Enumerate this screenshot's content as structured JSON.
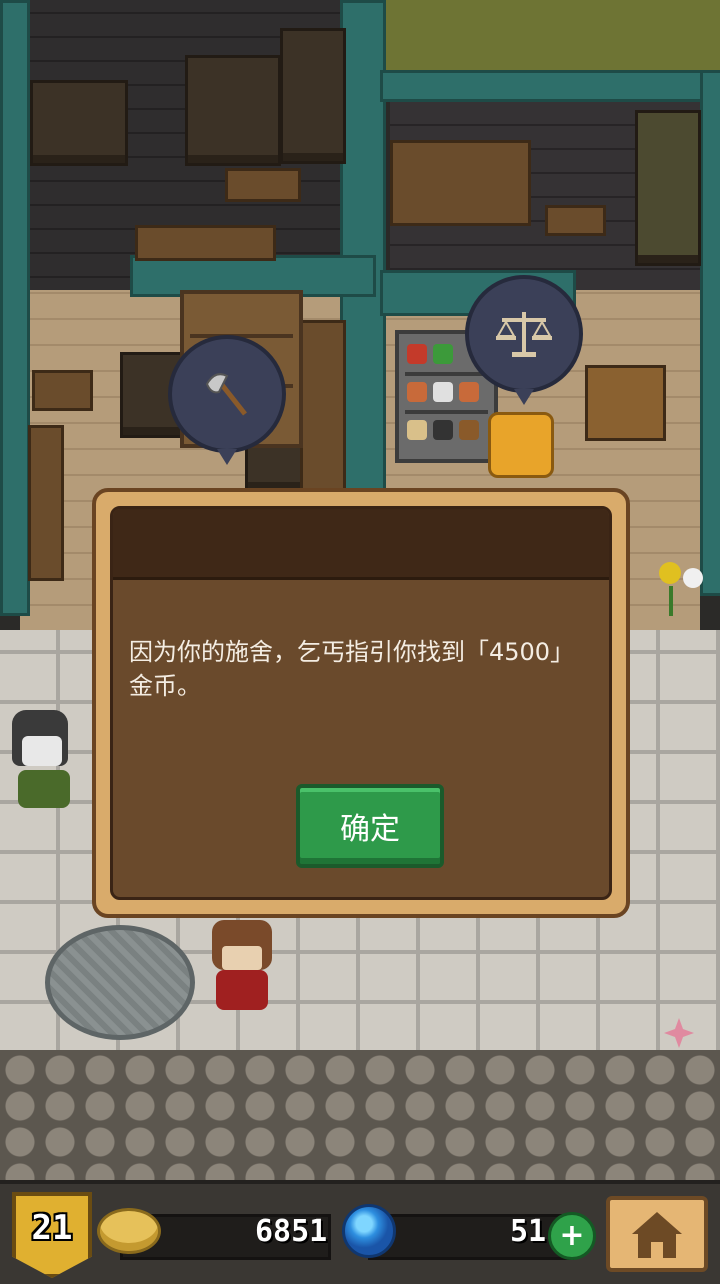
{
  "dialog": {
    "message": "因为你的施舍，乞丐指引你找到「4500」金币。",
    "confirm_label": "确定"
  },
  "hud": {
    "level": "21",
    "gold": "6851",
    "gems": "51",
    "plus_label": "+"
  },
  "icons": {
    "level": "shield-badge",
    "gold": "gold-coin",
    "gems": "blue-gem",
    "add": "plus",
    "home": "house",
    "shop_left": "axe",
    "shop_right": "balance-scale"
  },
  "colors": {
    "confirm_button": "#2e9a4a",
    "dialog_frame": "#d9ab6b",
    "dialog_body": "#6a4a2c",
    "hud_background": "#3a3733"
  }
}
